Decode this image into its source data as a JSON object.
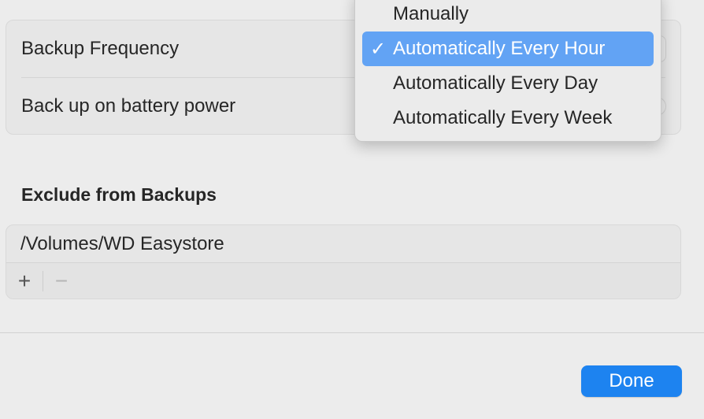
{
  "settings": {
    "backup_frequency_label": "Backup Frequency",
    "battery_label": "Back up on battery power"
  },
  "frequency_menu": {
    "items": [
      {
        "label": "Manually",
        "selected": false
      },
      {
        "label": "Automatically Every Hour",
        "selected": true
      },
      {
        "label": "Automatically Every Day",
        "selected": false
      },
      {
        "label": "Automatically Every Week",
        "selected": false
      }
    ],
    "check_glyph": "✓"
  },
  "exclude": {
    "title": "Exclude from Backups",
    "items": [
      "/Volumes/WD Easystore"
    ],
    "add_glyph": "+",
    "remove_glyph": "−"
  },
  "footer": {
    "done_label": "Done"
  },
  "colors": {
    "accent": "#1d83f0",
    "menu_highlight": "#62a3f4"
  }
}
